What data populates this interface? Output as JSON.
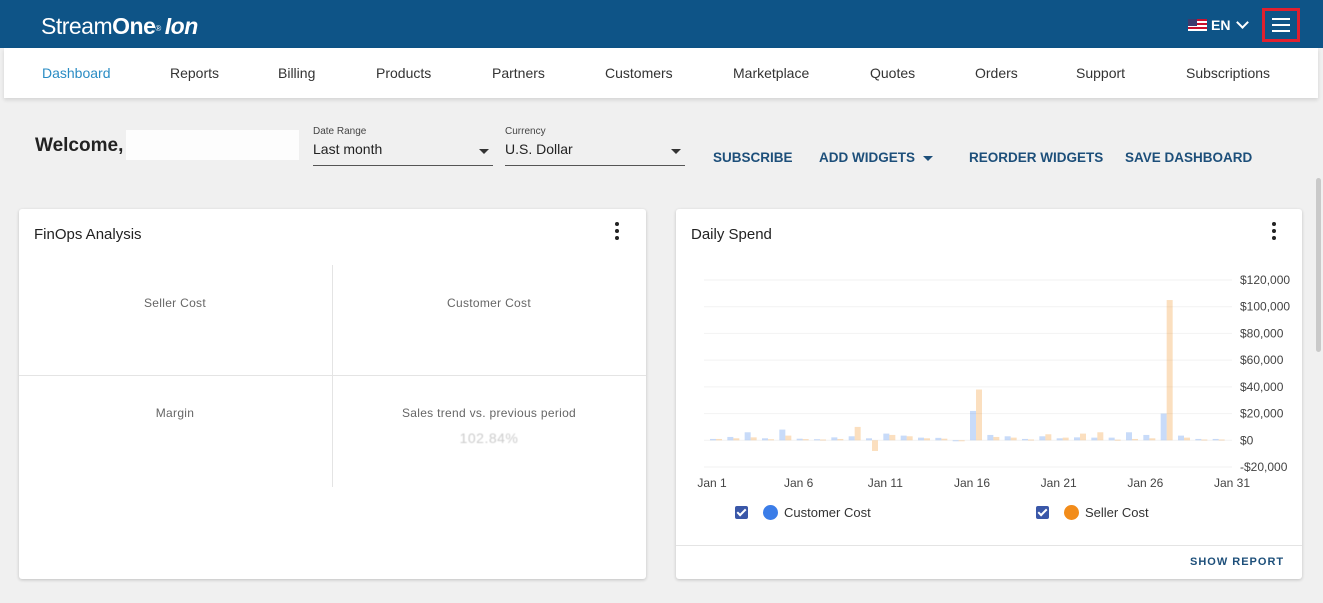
{
  "header": {
    "logo_main": "Stream",
    "logo_bold": "One",
    "logo_reg": "®",
    "logo_ion": "Ion",
    "language": "EN"
  },
  "nav": {
    "items": [
      "Dashboard",
      "Reports",
      "Billing",
      "Products",
      "Partners",
      "Customers",
      "Marketplace",
      "Quotes",
      "Orders",
      "Support",
      "Subscriptions"
    ],
    "active": "Dashboard"
  },
  "toolbar": {
    "welcome": "Welcome,",
    "date_range_label": "Date Range",
    "date_range_value": "Last month",
    "currency_label": "Currency",
    "currency_value": "U.S. Dollar",
    "subscribe": "SUBSCRIBE",
    "add_widgets": "ADD WIDGETS",
    "reorder_widgets": "REORDER WIDGETS",
    "save_dashboard": "SAVE DASHBOARD"
  },
  "finops": {
    "title": "FinOps Analysis",
    "seller_cost": "Seller Cost",
    "customer_cost": "Customer Cost",
    "margin": "Margin",
    "sales_trend": "Sales trend vs. previous period",
    "sales_trend_value": "102.84%"
  },
  "daily_spend": {
    "title": "Daily Spend",
    "show_report": "SHOW REPORT"
  },
  "chart_data": {
    "type": "bar",
    "title": "Daily Spend",
    "x_ticks": [
      "Jan 1",
      "Jan 6",
      "Jan 11",
      "Jan 16",
      "Jan 21",
      "Jan 26",
      "Jan 31"
    ],
    "y_ticks": [
      "$120,000",
      "$100,000",
      "$80,000",
      "$60,000",
      "$40,000",
      "$20,000",
      "$0",
      "-$20,000"
    ],
    "ylim": [
      -20000,
      120000
    ],
    "days": [
      1,
      2,
      3,
      4,
      5,
      6,
      7,
      8,
      9,
      10,
      11,
      12,
      13,
      14,
      15,
      16,
      17,
      18,
      19,
      20,
      21,
      22,
      23,
      24,
      25,
      26,
      27,
      28,
      29,
      30
    ],
    "series": [
      {
        "name": "Customer Cost",
        "color": "#3b7de8",
        "values": [
          1000,
          2500,
          6000,
          1500,
          8000,
          1200,
          800,
          2200,
          3000,
          1500,
          5000,
          3500,
          2000,
          1800,
          0,
          22000,
          4000,
          3000,
          1000,
          3000,
          1500,
          2200,
          2000,
          2000,
          6000,
          4000,
          20000,
          3500,
          1000,
          1000
        ]
      },
      {
        "name": "Seller Cost",
        "color": "#f28c1a",
        "values": [
          1000,
          1500,
          2200,
          800,
          3500,
          900,
          600,
          1000,
          10000,
          -8000,
          4000,
          3000,
          1500,
          1200,
          0,
          38000,
          2500,
          2000,
          600,
          4500,
          2000,
          5000,
          6000,
          500,
          1000,
          1500,
          105000,
          2000,
          600,
          600
        ]
      }
    ],
    "legend": [
      "Customer Cost",
      "Seller Cost"
    ],
    "legend_position": "bottom"
  }
}
